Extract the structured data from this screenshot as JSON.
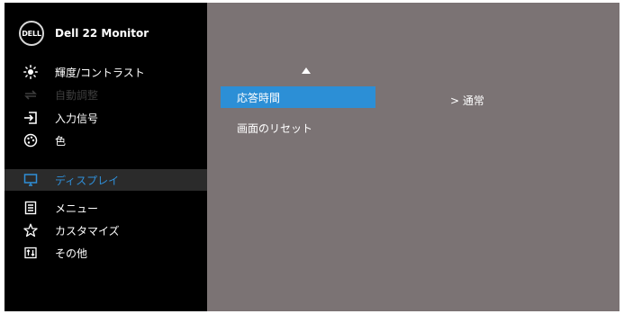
{
  "header": {
    "logo_text": "DELL",
    "model_name": "Dell 22 Monitor"
  },
  "sidebar": {
    "items": [
      {
        "label": "輝度/コントラスト",
        "icon": "brightness-icon",
        "state": "normal"
      },
      {
        "label": "自動調整",
        "icon": "auto-adjust-icon",
        "state": "disabled"
      },
      {
        "label": "入力信号",
        "icon": "input-source-icon",
        "state": "normal"
      },
      {
        "label": "色",
        "icon": "color-palette-icon",
        "state": "normal"
      },
      {
        "label": "ディスプレイ",
        "icon": "display-icon",
        "state": "active"
      },
      {
        "label": "メニュー",
        "icon": "menu-icon",
        "state": "normal"
      },
      {
        "label": "カスタマイズ",
        "icon": "star-icon",
        "state": "normal"
      },
      {
        "label": "その他",
        "icon": "others-icon",
        "state": "normal"
      }
    ]
  },
  "submenu": {
    "items": [
      {
        "label": "応答時間",
        "selected": true
      },
      {
        "label": "画面のリセット",
        "selected": false
      }
    ],
    "current_value": "> 通常"
  },
  "colors": {
    "active_text": "#2f8fd8",
    "selected_bg": "#2c8fd6",
    "panel_bg": "#7b7374",
    "sidebar_bg": "#000000"
  }
}
